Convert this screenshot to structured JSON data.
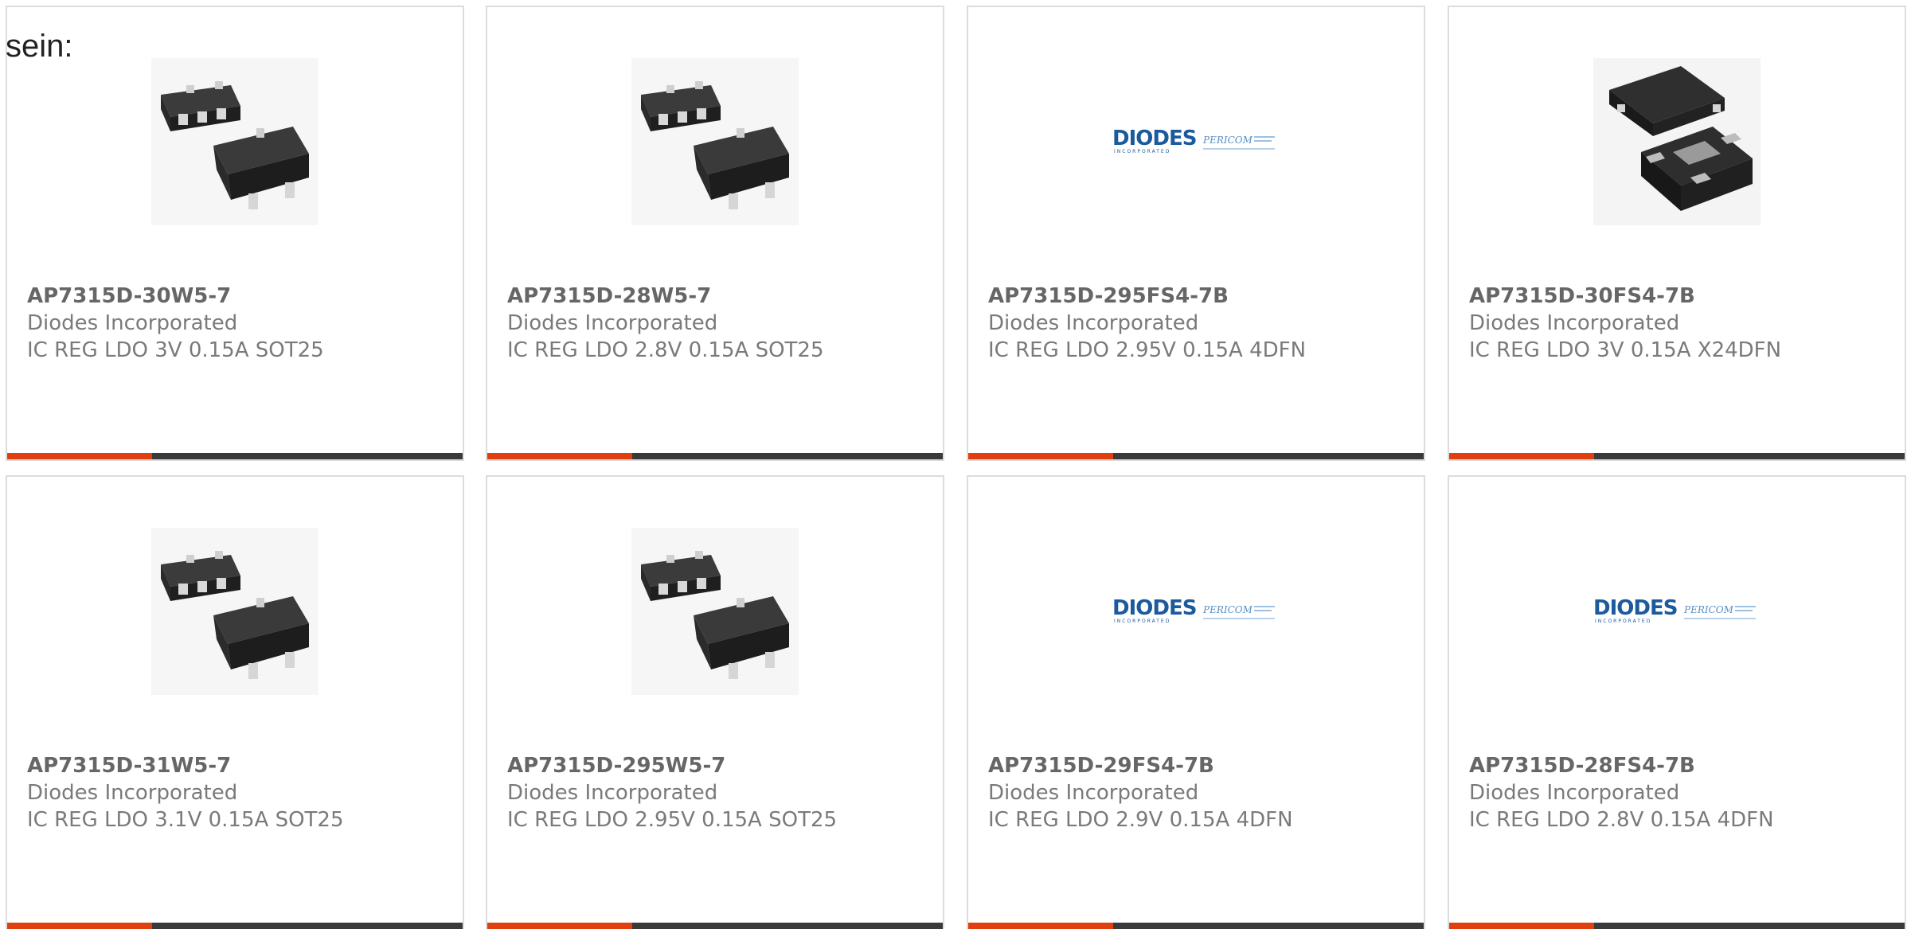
{
  "intro_text": "sein:",
  "accent_color": "#e0400f",
  "bar_color": "#3a3a3a",
  "products": [
    {
      "part_number": "AP7315D-30W5-7",
      "manufacturer": "Diodes Incorporated",
      "description": "IC REG LDO 3V 0.15A SOT25",
      "image": "sot25-package"
    },
    {
      "part_number": "AP7315D-28W5-7",
      "manufacturer": "Diodes Incorporated",
      "description": "IC REG LDO 2.8V 0.15A SOT25",
      "image": "sot25-package"
    },
    {
      "part_number": "AP7315D-295FS4-7B",
      "manufacturer": "Diodes Incorporated",
      "description": "IC REG LDO 2.95V 0.15A 4DFN",
      "image": "diodes-pericom-logo"
    },
    {
      "part_number": "AP7315D-30FS4-7B",
      "manufacturer": "Diodes Incorporated",
      "description": "IC REG LDO 3V 0.15A X24DFN",
      "image": "dfn-package"
    },
    {
      "part_number": "AP7315D-31W5-7",
      "manufacturer": "Diodes Incorporated",
      "description": "IC REG LDO 3.1V 0.15A SOT25",
      "image": "sot25-package"
    },
    {
      "part_number": "AP7315D-295W5-7",
      "manufacturer": "Diodes Incorporated",
      "description": "IC REG LDO 2.95V 0.15A SOT25",
      "image": "sot25-package"
    },
    {
      "part_number": "AP7315D-29FS4-7B",
      "manufacturer": "Diodes Incorporated",
      "description": "IC REG LDO 2.9V 0.15A 4DFN",
      "image": "diodes-pericom-logo"
    },
    {
      "part_number": "AP7315D-28FS4-7B",
      "manufacturer": "Diodes Incorporated",
      "description": "IC REG LDO 2.8V 0.15A 4DFN",
      "image": "diodes-pericom-logo"
    }
  ],
  "logo": {
    "brand_text": "DIODES",
    "brand_sub": "INCORPORATED",
    "partner_text": "PERICOM"
  }
}
